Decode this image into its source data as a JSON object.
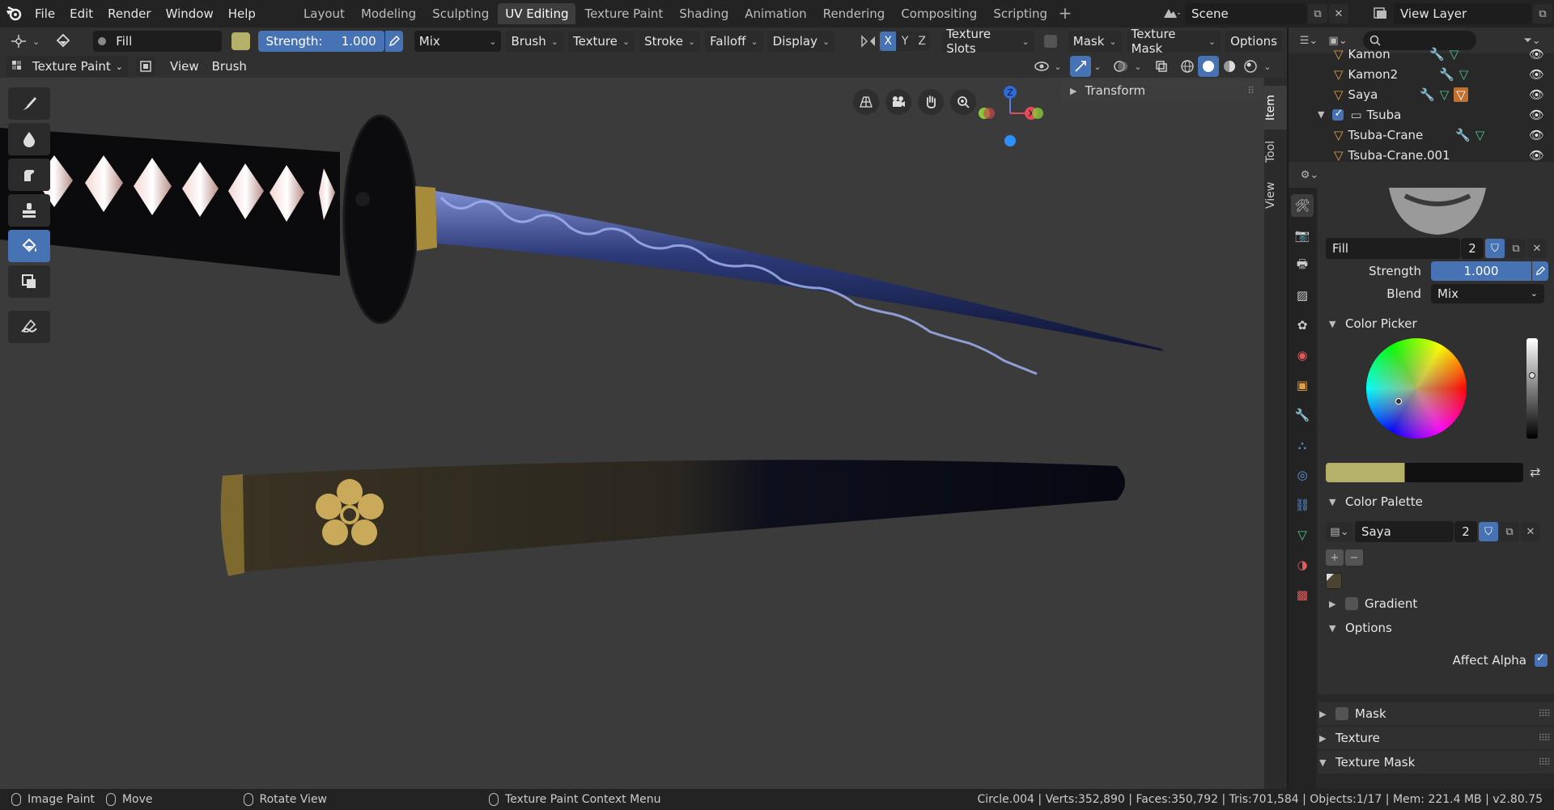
{
  "menu": [
    "File",
    "Edit",
    "Render",
    "Window",
    "Help"
  ],
  "workspaces": {
    "tabs": [
      "Layout",
      "Modeling",
      "Sculpting",
      "UV Editing",
      "Texture Paint",
      "Shading",
      "Animation",
      "Rendering",
      "Compositing",
      "Scripting"
    ],
    "active": "UV Editing"
  },
  "scene": {
    "name": "Scene",
    "view_layer": "View Layer"
  },
  "tool_settings": {
    "brush_name": "Fill",
    "strength_label": "Strength:",
    "strength_value": "1.000",
    "blend": "Mix",
    "brush": "Brush",
    "texture": "Texture",
    "stroke": "Stroke",
    "falloff": "Falloff",
    "display": "Display",
    "axes": [
      "X",
      "Y",
      "Z"
    ],
    "texture_slots": "Texture Slots",
    "mask": "Mask",
    "texture_mask": "Texture Mask",
    "options": "Options",
    "brush_color": "#b5b06a"
  },
  "header2": {
    "mode": "Texture Paint",
    "view": "View",
    "brush": "Brush"
  },
  "npanel": {
    "transform": "Transform",
    "tabs": [
      "Item",
      "Tool",
      "View"
    ]
  },
  "gizmo": {
    "z": "Z",
    "x": "X"
  },
  "outliner": {
    "rows": [
      {
        "name": "Kamon",
        "type": "mesh",
        "indent": 1
      },
      {
        "name": "Kamon2",
        "type": "mesh",
        "indent": 1
      },
      {
        "name": "Saya",
        "type": "mesh",
        "indent": 1
      },
      {
        "name": "Tsuba",
        "type": "collection",
        "indent": 0
      },
      {
        "name": "Tsuba-Crane",
        "type": "mesh",
        "indent": 1
      },
      {
        "name": "Tsuba-Crane.001",
        "type": "mesh",
        "indent": 1
      }
    ]
  },
  "properties": {
    "brush_name": "Fill",
    "brush_users": "2",
    "strength_label": "Strength",
    "strength_value": "1.000",
    "blend_label": "Blend",
    "blend_value": "Mix",
    "color_picker": "Color Picker",
    "color_palette": "Color Palette",
    "palette_name": "Saya",
    "palette_users": "2",
    "gradient": "Gradient",
    "options": "Options",
    "affect_alpha": "Affect Alpha",
    "mask": "Mask",
    "texture": "Texture",
    "texture_mask": "Texture Mask",
    "current_color": "#b5b06a"
  },
  "status": {
    "left_action": "Image Paint",
    "middle_action": "Move",
    "rotate": "Rotate View",
    "context": "Texture Paint Context Menu",
    "stats": "Circle.004 | Verts:352,890 | Faces:350,792 | Tris:701,584 | Objects:1/17 | Mem: 221.4 MB | v2.80.75"
  }
}
